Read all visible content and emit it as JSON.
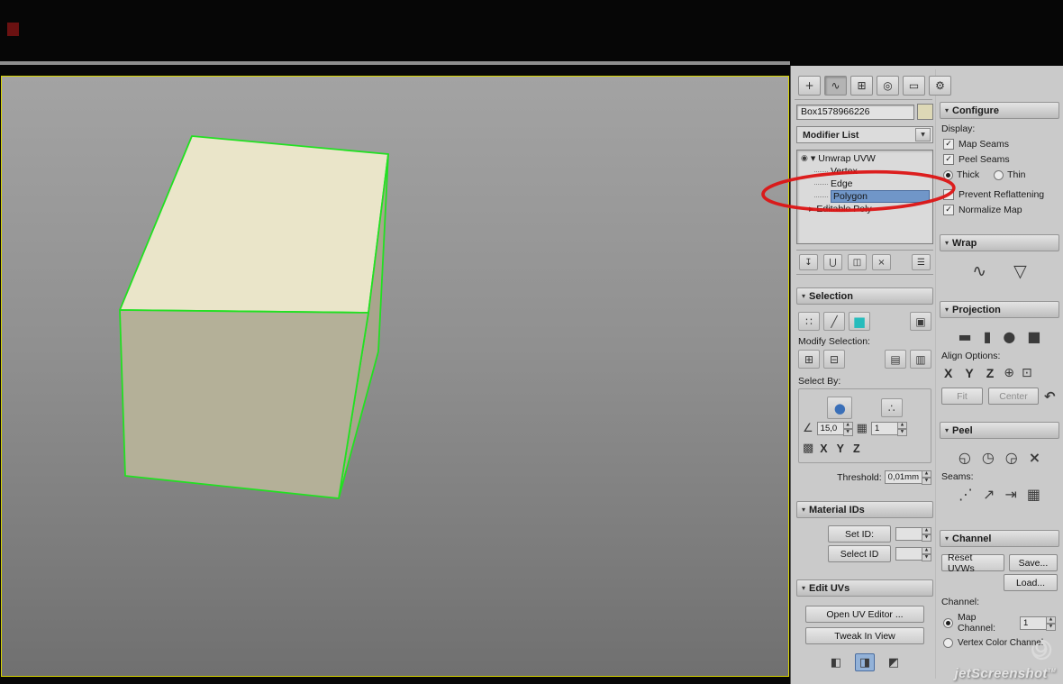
{
  "annotation": {
    "color": "#dc1414"
  },
  "viewport": {
    "box": {
      "top_color": "#eae5c9",
      "front_color": "#b4b098",
      "right_color": "#a9a58d",
      "edge_color": "#22e022"
    }
  },
  "icons": {
    "tab-create": "+",
    "tab-modify": "∿",
    "tab-hierarchy": "⊞",
    "tab-motion": "◎",
    "tab-display": "▭",
    "tab-utilities": "⚙",
    "dropdown-arrow": "▼",
    "roll-arrow": "▾",
    "eye": "◉",
    "expanded": "▼",
    "collapsed": "▶",
    "pin-stack": "↧",
    "show-end-result": "⋃",
    "make-unique": "◫",
    "remove-modifier": "×",
    "configure-sets": "☰",
    "vertex-mode": "∷",
    "edge-mode": "╱",
    "polygon-mode": "■",
    "select-element": "▣",
    "grow": "⊞",
    "shrink": "⊟",
    "ring": "▤",
    "loop": "▥",
    "smoothing-group": "●",
    "planar-select": "∴",
    "angle-cursor": "∠",
    "matid-grid": "▦",
    "checker": "▩",
    "spin-up": "▲",
    "spin-down": "▼",
    "check": "✓",
    "edituv-a": "◧",
    "edituv-b": "◨",
    "edituv-c": "◩",
    "wrap-spline": "∿",
    "wrap-unfold": "▽",
    "proj-planar": "▬",
    "proj-cyl": "▮",
    "proj-sph": "●",
    "proj-box": "■",
    "align-view": "⊕",
    "align-region": "⊡",
    "reset": "↶",
    "peel-quick": "◵",
    "peel-mode": "◷",
    "peel-pelt": "◶",
    "peel-reset": "×",
    "seam-edit": "⋰",
    "seam-p2p": "↗",
    "seam-convert": "⇥",
    "seam-grid": "▦"
  },
  "command_panel": {
    "object_name": "Box1578966226",
    "modifier_list_label": "Modifier List",
    "stack": {
      "items": [
        {
          "label": "Unwrap UVW"
        },
        {
          "label": "Vertex"
        },
        {
          "label": "Edge"
        },
        {
          "label": "Polygon"
        },
        {
          "label": "Editable Poly"
        }
      ]
    },
    "selection": {
      "title": "Selection",
      "modify_label": "Modify Selection:",
      "select_by_label": "Select By:",
      "angle_value": "15,0",
      "matid_value": "1",
      "x": "X",
      "y": "Y",
      "z": "Z",
      "threshold_label": "Threshold:",
      "threshold_value": "0,01mm"
    },
    "material_ids": {
      "title": "Material IDs",
      "set_id": "Set ID:",
      "set_id_value": "",
      "select_id": "Select ID",
      "select_id_value": ""
    },
    "edit_uvs": {
      "title": "Edit UVs",
      "open": "Open UV Editor ...",
      "tweak": "Tweak In View"
    },
    "configure": {
      "title": "Configure",
      "display_label": "Display:",
      "map_seams": "Map Seams",
      "peel_seams": "Peel Seams",
      "thick": "Thick",
      "thin": "Thin",
      "prevent_reflattening": "Prevent Reflattening",
      "normalize_map": "Normalize Map"
    },
    "wrap": {
      "title": "Wrap"
    },
    "projection": {
      "title": "Projection",
      "align_label": "Align Options:",
      "x": "X",
      "y": "Y",
      "z": "Z",
      "fit": "Fit",
      "center": "Center"
    },
    "peel": {
      "title": "Peel",
      "seams_label": "Seams:"
    },
    "channel": {
      "title": "Channel",
      "reset_uvws": "Reset UVWs",
      "save": "Save...",
      "load": "Load...",
      "channel_label": "Channel:",
      "map_channel": "Map Channel:",
      "map_channel_value": "1",
      "vertex_color": "Vertex Color Channel"
    }
  },
  "watermark": {
    "text": "jetScreenshot",
    "tm": "TM"
  }
}
